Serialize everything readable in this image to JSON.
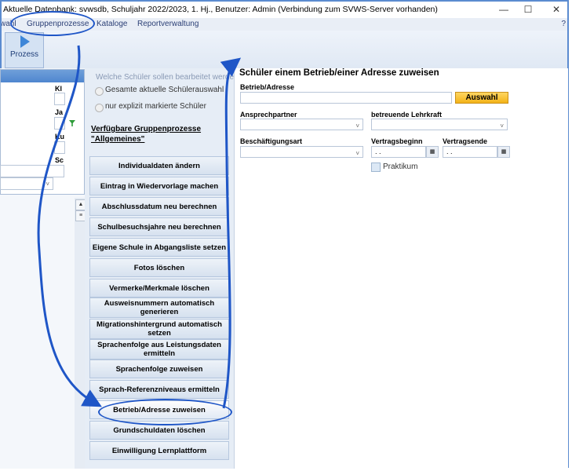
{
  "window": {
    "title": "Aktuelle Datenbank: svwsdb, Schuljahr 2022/2023, 1. Hj., Benutzer: Admin (Verbindung zum SVWS-Server vorhanden)",
    "controls": {
      "minimize": "—",
      "maximize": "☐",
      "close": "✕"
    }
  },
  "menu": {
    "items": [
      "wahl",
      "Gruppenprozesse",
      "Kataloge",
      "Reportverwaltung"
    ],
    "help": "?"
  },
  "ribbon": {
    "prozess_label": "Prozess"
  },
  "left": {
    "labels": [
      "Kl",
      "Ja",
      "Ku",
      "Sc"
    ],
    "scroll_up": "▲",
    "scroll_grip": "≡"
  },
  "middle": {
    "question": "Welche Schüler sollen bearbeitet werden",
    "radio_current": "Gesamte aktuelle Schülerauswahl",
    "radio_marked": "nur explizit markierte Schüler",
    "available_title": "Verfügbare Gruppenprozesse",
    "available_sub": "\"Allgemeines\"",
    "buttons": [
      "Individualdaten ändern",
      "Eintrag in Wiedervorlage machen",
      "Abschlussdatum neu berechnen",
      "Schulbesuchsjahre neu berechnen",
      "Eigene Schule in Abgangsliste setzen",
      "Fotos löschen",
      "Vermerke/Merkmale löschen",
      "Ausweisnummern automatisch generieren",
      "Migrationshintergrund automatisch setzen",
      "Sprachenfolge aus Leistungsdaten ermitteln",
      "Sprachenfolge zuweisen",
      "Sprach-Referenzniveaus ermitteln",
      "Betrieb/Adresse zuweisen",
      "Grundschuldaten löschen",
      "Einwilligung Lernplattform"
    ]
  },
  "form": {
    "title": "Schüler einem Betrieb/einer Adresse zuweisen",
    "betrieb_label": "Betrieb/Adresse",
    "betrieb_value": "",
    "auswahl_button": "Auswahl",
    "ansprechpartner_label": "Ansprechpartner",
    "lehrkraft_label": "betreuende Lehrkraft",
    "beschaeftigungsart_label": "Beschäftigungsart",
    "vertragsbeginn_label": "Vertragsbeginn",
    "vertragsende_label": "Vertragsende",
    "vertragsbeginn_value": ". .",
    "vertragsende_value": ". .",
    "praktikum_label": "Praktikum",
    "dropdown_caret": "˅",
    "calendar_icon_glyph": "▦"
  },
  "colors": {
    "accent": "#1f56c7",
    "auswahl": "#f3b318",
    "panel": "#e6edf6"
  }
}
